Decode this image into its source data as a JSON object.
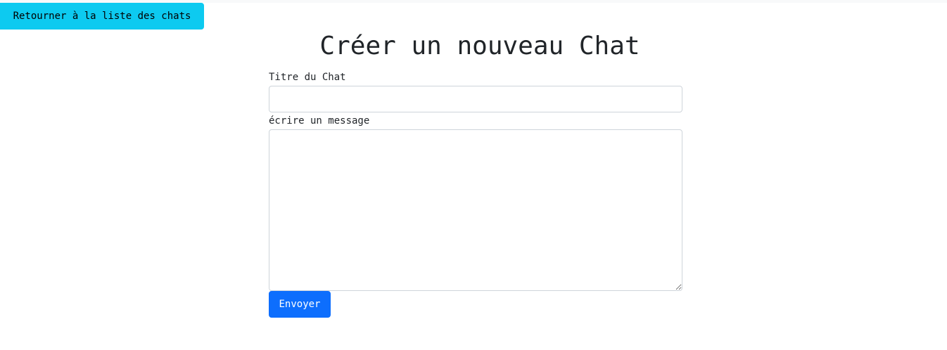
{
  "colors": {
    "back_button_bg": "#0dcaf0",
    "send_button_bg": "#0d6efd",
    "text": "#212529",
    "input_border": "#ced4da"
  },
  "nav": {
    "back_label": "Retourner à la liste des chats"
  },
  "page": {
    "title": "Créer un nouveau Chat"
  },
  "form": {
    "title_label": "Titre du Chat",
    "title_value": "",
    "message_label": "écrire un message",
    "message_value": "",
    "submit_label": "Envoyer"
  }
}
